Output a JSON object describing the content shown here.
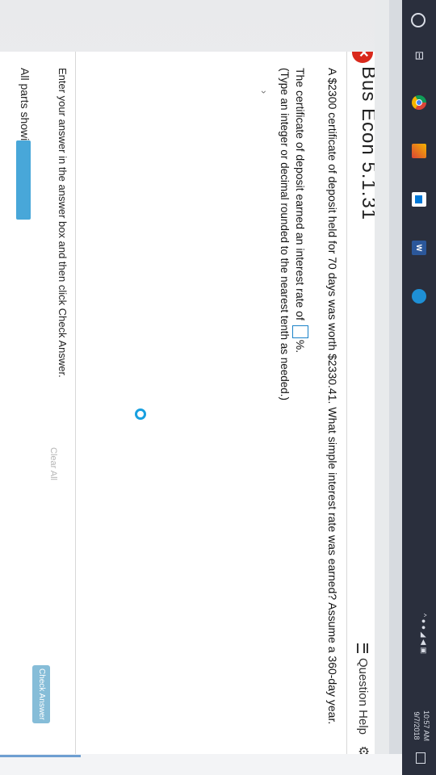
{
  "window": {
    "title": "Bus Econ 5.1.31",
    "close_icon": "close-x-icon",
    "question_help_label": "Question Help",
    "gear_icon": "gear-icon"
  },
  "question": {
    "text": "A $2300 certificate of deposit held for 70 days was worth $2330.41. What simple interest rate was earned? Assume a 360-day year.",
    "answer_prefix": "The certificate of deposit earned an interest rate of",
    "answer_value": "",
    "answer_suffix": "%.",
    "hint": "(Type an integer or decimal rounded to the nearest tenth as needed.)"
  },
  "footer": {
    "instructions": "Enter your answer in the answer box and then click Check Answer.",
    "parts_label": "All parts showing",
    "progress_fraction": 1.0,
    "clear_all_label": "Clear All",
    "check_answer_label": "Check Answer",
    "help_symbol": "?",
    "nav_prev_symbol": "◀",
    "nav_next_symbol": "▶"
  },
  "taskbar": {
    "icons": [
      "cortana-circle-icon",
      "task-view-icon",
      "chrome-icon",
      "photos-icon",
      "store-icon",
      "word-icon",
      "edge-icon"
    ],
    "word_label": "W",
    "tray_text": "^ ● ● ◢ ◀ ▣",
    "clock_time": "10:57 AM",
    "clock_date": "9/7/2018"
  },
  "colors": {
    "accent": "#1a82c8",
    "progress": "#48a7d9",
    "close": "#d9291c"
  }
}
